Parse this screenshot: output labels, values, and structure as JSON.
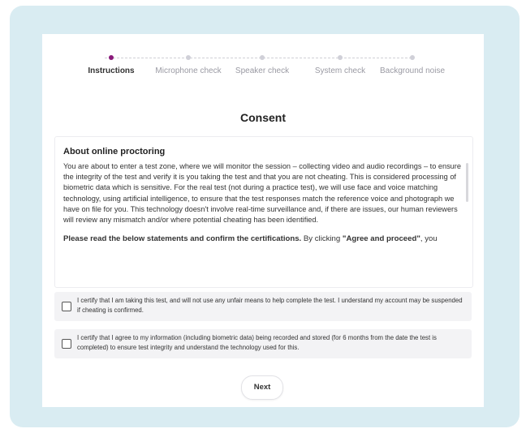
{
  "stepper": {
    "steps": [
      {
        "label": "Instructions"
      },
      {
        "label": "Microphone check"
      },
      {
        "label": "Speaker check"
      },
      {
        "label": "System check"
      },
      {
        "label": "Background noise"
      }
    ],
    "active_step": "Instructions",
    "colors": {
      "active": "#8a1a7a",
      "inactive": "#d0d0d8"
    }
  },
  "page": {
    "title": "Consent"
  },
  "about": {
    "heading": "About online proctoring",
    "body": "You are about to enter a test zone, where we will monitor the session – collecting video and audio recordings – to ensure the integrity of the test and verify it is you taking the test and that you are not cheating. This is considered processing of biometric data which is sensitive. For the real test (not during a practice test), we will use face and voice matching technology, using artificial intelligence, to ensure that the test responses match the reference voice and photograph we have on file for you. This technology doesn't involve real-time surveillance and, if there are issues, our human reviewers will review any mismatch and/or where potential cheating has been identified.",
    "instruction_bold": "Please read the below statements and confirm the certifications.",
    "instruction_rest_1": " By clicking ",
    "instruction_quote": "\"Agree and proceed\"",
    "instruction_rest_2": ", you"
  },
  "certifications": [
    {
      "text": "I certify that I am taking this test, and will not use any unfair means to help complete the test. I understand my account may be suspended if cheating is confirmed.",
      "checked": false
    },
    {
      "text": "I certify that I agree to my information (including biometric data) being recorded and stored (for 6 months from the date the test is completed) to ensure test integrity and understand the technology used for this.",
      "checked": false
    }
  ],
  "actions": {
    "next_label": "Next"
  },
  "colors": {
    "frame_bg": "#d9ecf2",
    "card_bg": "#ffffff",
    "cert_bg": "#f3f3f5"
  }
}
